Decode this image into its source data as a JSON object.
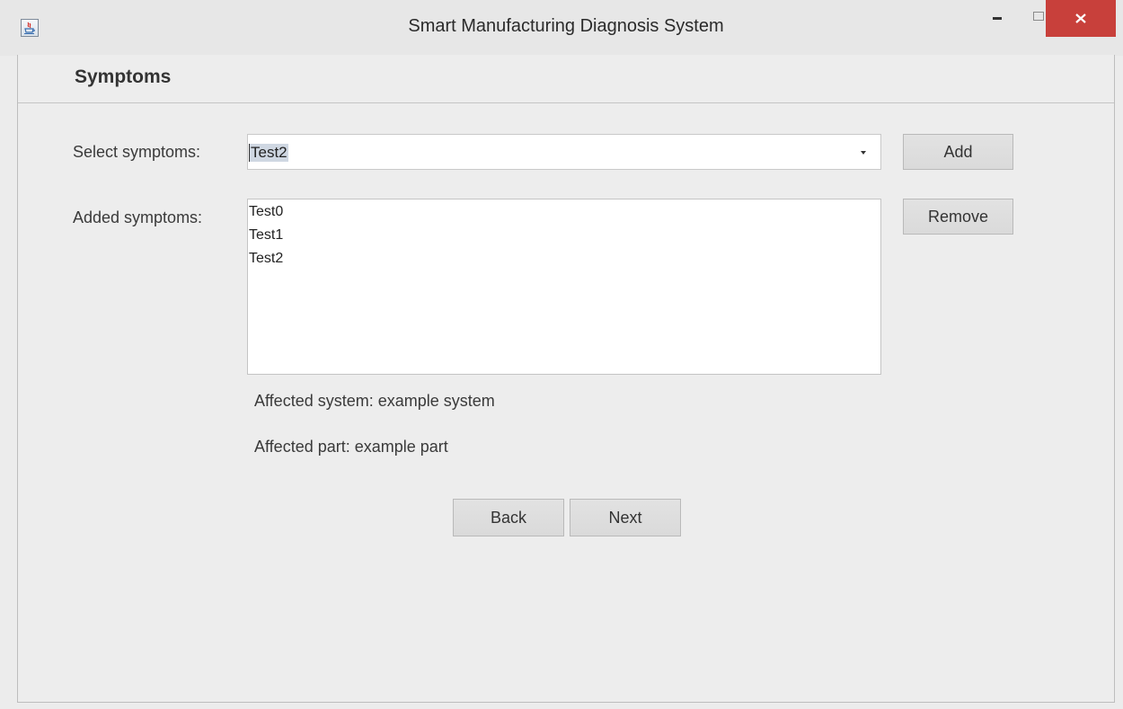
{
  "window": {
    "title": "Smart Manufacturing Diagnosis System",
    "controls": {
      "minimize": "minimize",
      "maximize": "maximize",
      "close": "close"
    },
    "close_color": "#c8403b"
  },
  "header": {
    "title": "Symptoms"
  },
  "select_symptoms": {
    "label": "Select symptoms:",
    "selected_value": "Test2",
    "add_label": "Add"
  },
  "added_symptoms": {
    "label": "Added symptoms:",
    "items": [
      "Test0",
      "Test1",
      "Test2"
    ],
    "remove_label": "Remove"
  },
  "info": {
    "affected_system": "Affected system: example system",
    "affected_part": "Affected part: example part"
  },
  "nav": {
    "back_label": "Back",
    "next_label": "Next"
  },
  "icons": {
    "app": "java-app-icon",
    "dropdown": "chevron-down-icon"
  }
}
